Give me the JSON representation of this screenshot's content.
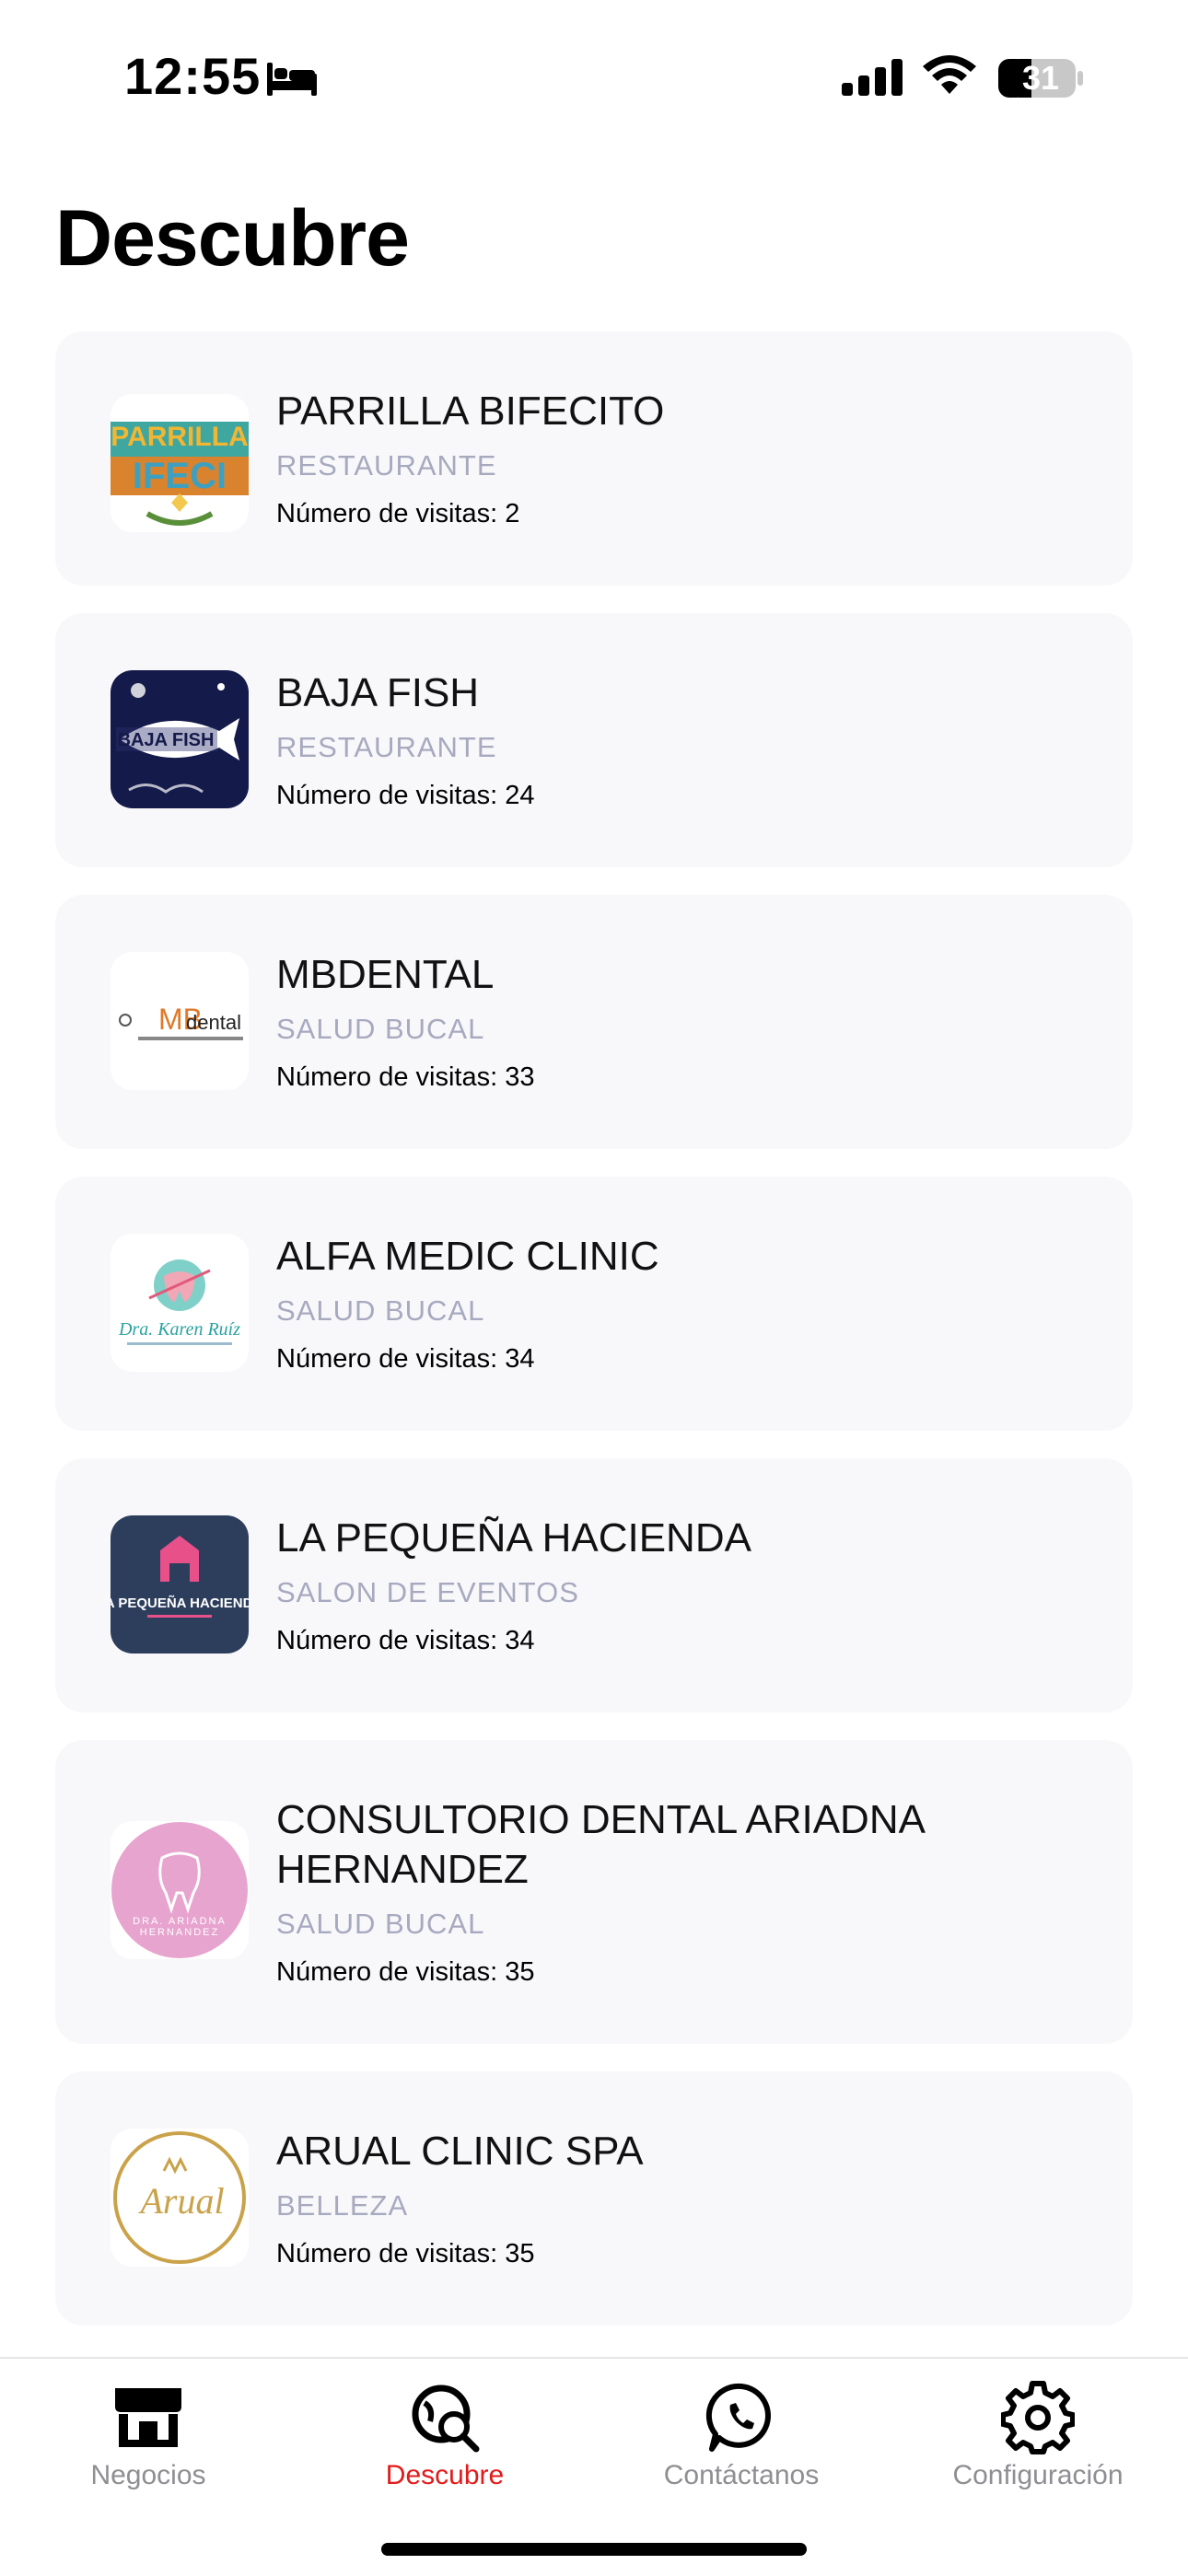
{
  "status_bar": {
    "time": "12:55",
    "battery": "31"
  },
  "page_title": "Descubre",
  "businesses": [
    {
      "name": "PARRILLA BIFECITO",
      "category": "RESTAURANTE",
      "visits": "Número de visitas: 2",
      "logo_text": "PARRILLA BIFECITO"
    },
    {
      "name": "BAJA FISH",
      "category": "RESTAURANTE",
      "visits": "Número de visitas: 24",
      "logo_text": "BAJA FISH"
    },
    {
      "name": "MBDENTAL",
      "category": "SALUD BUCAL",
      "visits": "Número de visitas: 33",
      "logo_text": "MBdental"
    },
    {
      "name": "ALFA MEDIC CLINIC",
      "category": "SALUD BUCAL",
      "visits": "Número de visitas: 34",
      "logo_text": "Dra. Karen Ruíz"
    },
    {
      "name": "LA PEQUEÑA HACIENDA",
      "category": "SALON DE EVENTOS",
      "visits": "Número de visitas: 34",
      "logo_text": "LA PEQUEÑA HACIENDA"
    },
    {
      "name": "CONSULTORIO DENTAL ARIADNA HERNANDEZ",
      "category": "SALUD BUCAL",
      "visits": "Número de visitas: 35",
      "logo_text": "DRA. ARIADNA HERNANDEZ"
    },
    {
      "name": "ARUAL CLINIC SPA",
      "category": "BELLEZA",
      "visits": "Número de visitas: 35",
      "logo_text": "Arual"
    }
  ],
  "tabs": [
    {
      "label": "Negocios",
      "icon": "store-icon"
    },
    {
      "label": "Descubre",
      "icon": "discover-search-icon"
    },
    {
      "label": "Contáctanos",
      "icon": "whatsapp-icon"
    },
    {
      "label": "Configuración",
      "icon": "gear-icon"
    }
  ],
  "colors": {
    "accent": "#e21b1b",
    "card_bg": "#f8f8fa",
    "category_text": "#a7a9bf",
    "inactive_tab": "#8e8e93"
  }
}
